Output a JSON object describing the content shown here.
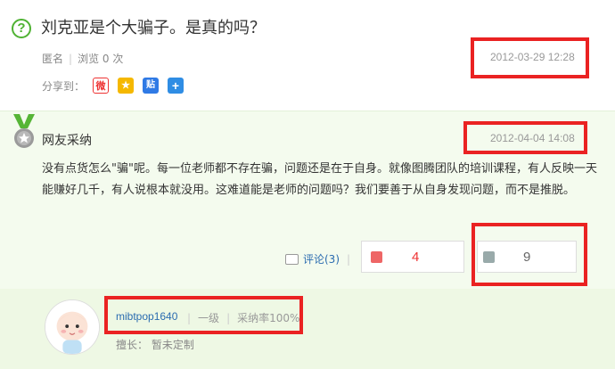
{
  "question": {
    "title": "刘克亚是个大骗子。是真的吗？",
    "author": "匿名",
    "views": "浏览 0 次",
    "time": "2012-03-29 12:28",
    "share_label": "分享到：",
    "share_icons": [
      "weibo-icon",
      "qzone-icon",
      "tieba-icon",
      "more-share-icon"
    ]
  },
  "answer": {
    "label": "网友采纳",
    "time": "2012-04-04 14:08",
    "body": "没有点货怎么\"骗\"呢。每一位老师都不存在骗，问题还是在于自身。就像图腾团队的培训课程，有人反映一天能赚好几千，有人说根本就没用。这难道能是老师的问题吗？我们要善于从自身发现问题，而不是推脱。",
    "comment_label": "评论(3)",
    "upvotes": "4",
    "downvotes": "9"
  },
  "user": {
    "name": "mibtpop1640",
    "level": "一级",
    "adopt_rate": "采纳率100%",
    "skill": "擅长： 暂未定制"
  },
  "colors": {
    "accent_green": "#4fb233",
    "highlight_red": "#ea2222",
    "link_blue": "#2b6cb0",
    "answer_bg": "#f4fbee"
  }
}
